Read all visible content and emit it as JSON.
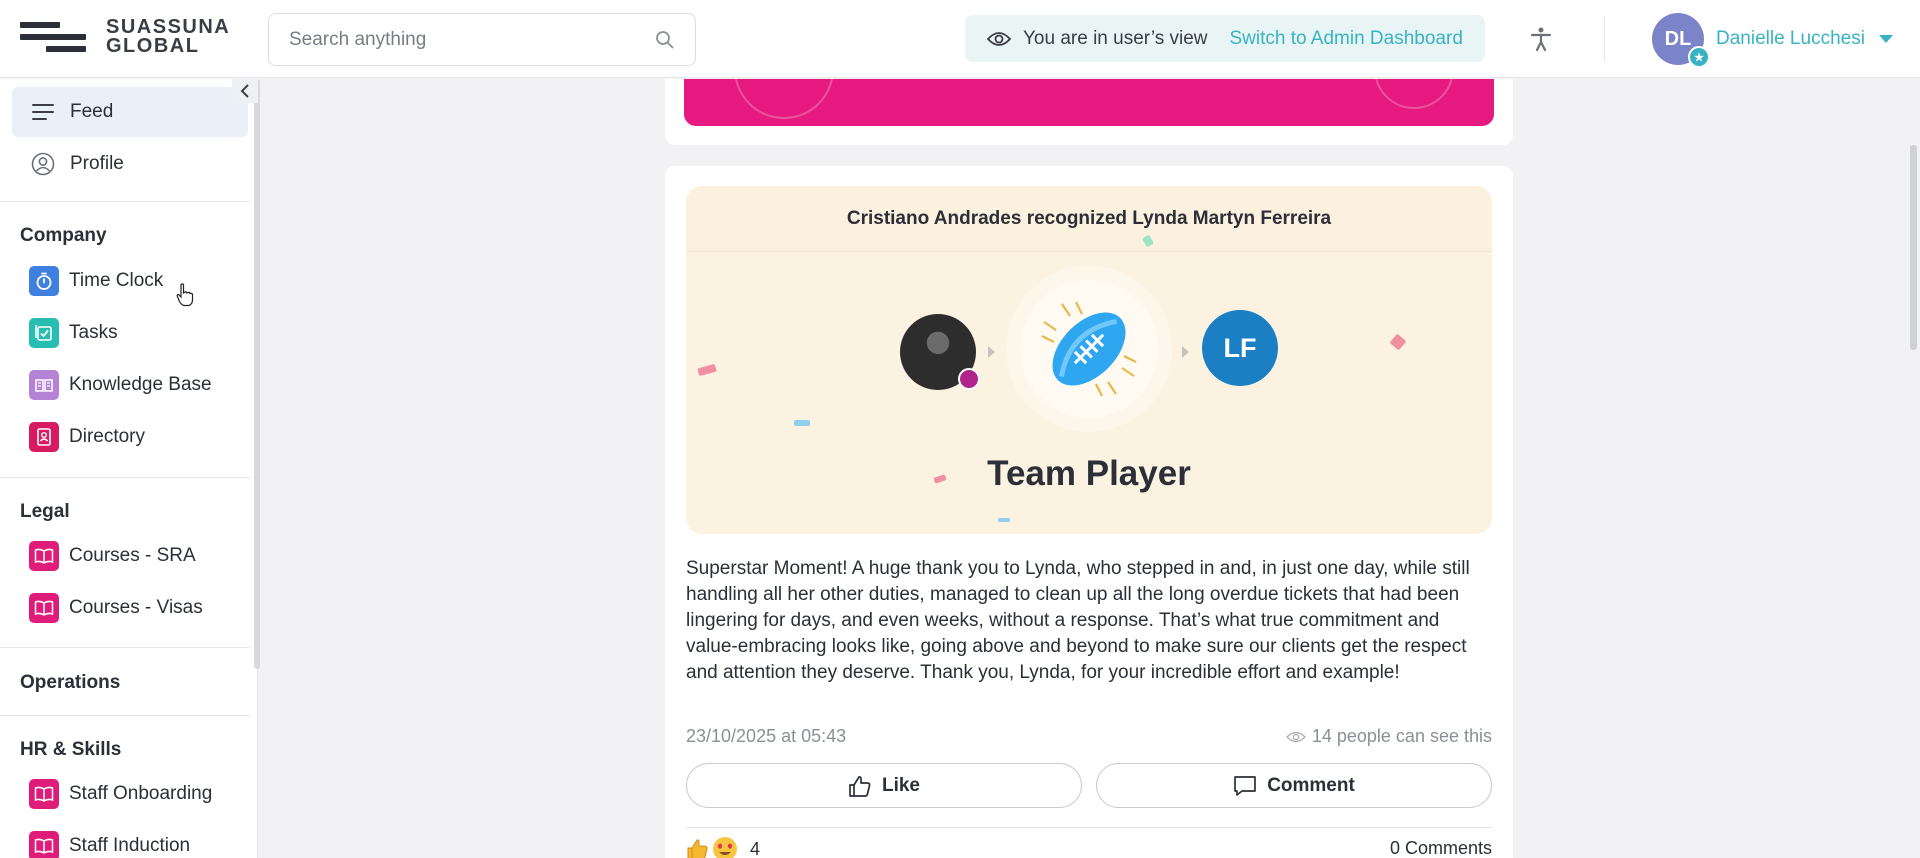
{
  "header": {
    "logo_line1": "SUASSUNA",
    "logo_line2": "GLOBAL",
    "search_placeholder": "Search anything",
    "view_banner_text": "You are in user’s view",
    "switch_link": "Switch to Admin Dashboard",
    "user_initials": "DL",
    "user_name": "Danielle Lucchesi"
  },
  "sidebar": {
    "top_items": [
      {
        "label": "Feed",
        "icon": "menu-lines-icon"
      },
      {
        "label": "Profile",
        "icon": "user-circle-icon"
      }
    ],
    "sections": [
      {
        "title": "Company",
        "items": [
          {
            "label": "Time Clock",
            "icon": "stopwatch-icon",
            "color": "#3f7fe0"
          },
          {
            "label": "Tasks",
            "icon": "checklist-icon",
            "color": "#27bdb0"
          },
          {
            "label": "Knowledge Base",
            "icon": "book-open-icon",
            "color": "#b583d6"
          },
          {
            "label": "Directory",
            "icon": "contacts-book-icon",
            "color": "#d81b60"
          }
        ]
      },
      {
        "title": "Legal",
        "items": [
          {
            "label": "Courses - SRA",
            "icon": "book-icon",
            "color": "#e01c7b"
          },
          {
            "label": "Courses - Visas",
            "icon": "book-icon",
            "color": "#e01c7b"
          }
        ]
      },
      {
        "title": "Operations",
        "items": []
      },
      {
        "title": "HR & Skills",
        "items": [
          {
            "label": "Staff Onboarding",
            "icon": "book-icon",
            "color": "#e01c7b"
          },
          {
            "label": "Staff Induction",
            "icon": "book-icon",
            "color": "#e01c7b"
          }
        ]
      }
    ]
  },
  "post": {
    "recognition_header": "Cristiano Andrades recognized Lynda Martyn Ferreira",
    "receiver_initials": "LF",
    "award_title": "Team Player",
    "body": "Superstar Moment! A huge thank you to Lynda, who stepped in and, in just one day, while still handling all her other duties, managed to clean up all the long overdue tickets that had been lingering for days, and even weeks, without a response. That’s what true commitment and value-embracing looks like, going above and beyond to make sure our clients get the respect and attention they deserve. Thank you, Lynda, for your incredible effort and example!",
    "date": "23/10/2025 at 05:43",
    "visibility": "14 people can see this",
    "like_label": "Like",
    "comment_label": "Comment",
    "reaction_count": "4",
    "comments_count": "0 Comments"
  },
  "colors": {
    "accent": "#37b3c3",
    "banner_pink": "#e5197f",
    "recognition_bg": "#fcf2e2",
    "receiver_avatar": "#1a7fc3",
    "user_avatar": "#7b83c9"
  }
}
